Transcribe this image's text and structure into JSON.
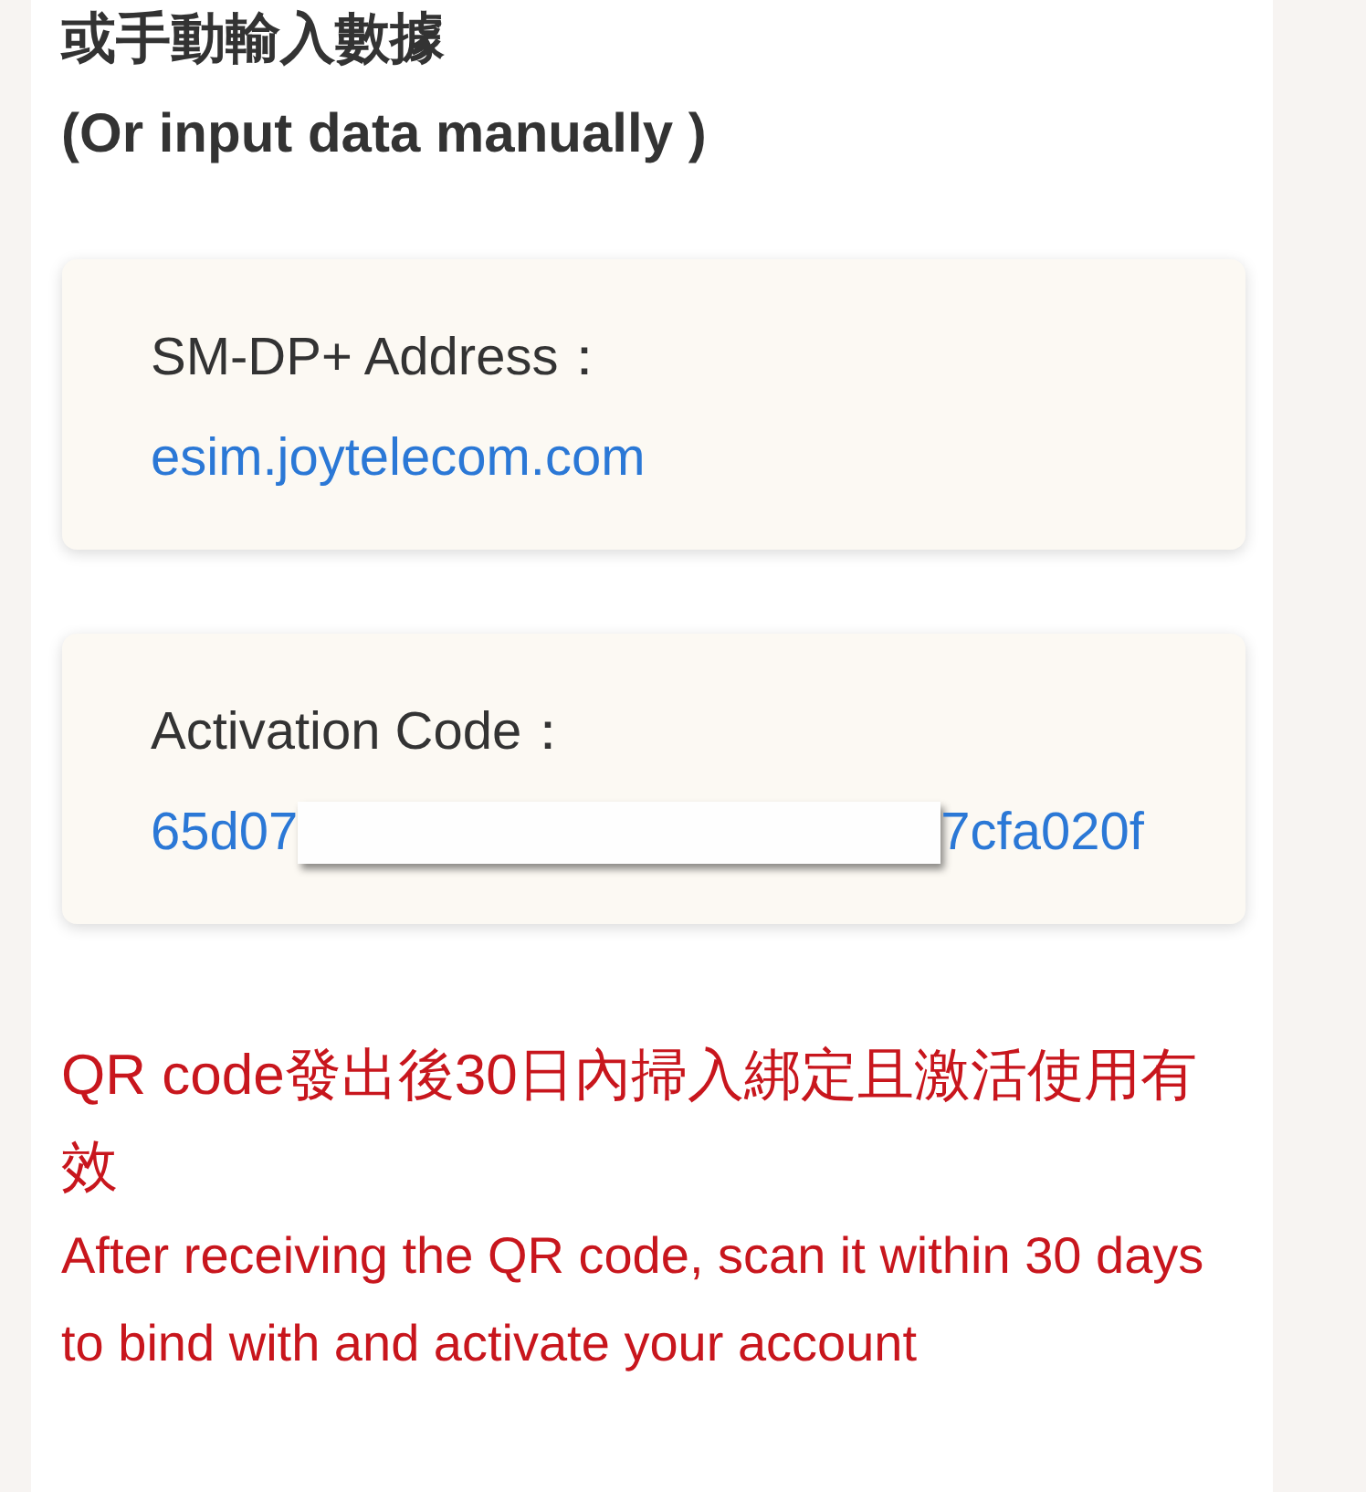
{
  "heading": {
    "chinese": "或手動輸入數據",
    "english": "(Or input data manually )"
  },
  "cards": [
    {
      "label": "SM-DP+ Address：",
      "kind": "plain",
      "value": "esim.joytelecom.com"
    },
    {
      "label": "Activation Code：",
      "kind": "redacted",
      "value_start": "65d07",
      "value_end": "7cfa020f"
    }
  ],
  "notice": {
    "chinese": "QR code發出後30日內掃入綁定且激活使用有效",
    "english": "After receiving the QR code, scan it within 30 days to bind with and activate your account"
  }
}
